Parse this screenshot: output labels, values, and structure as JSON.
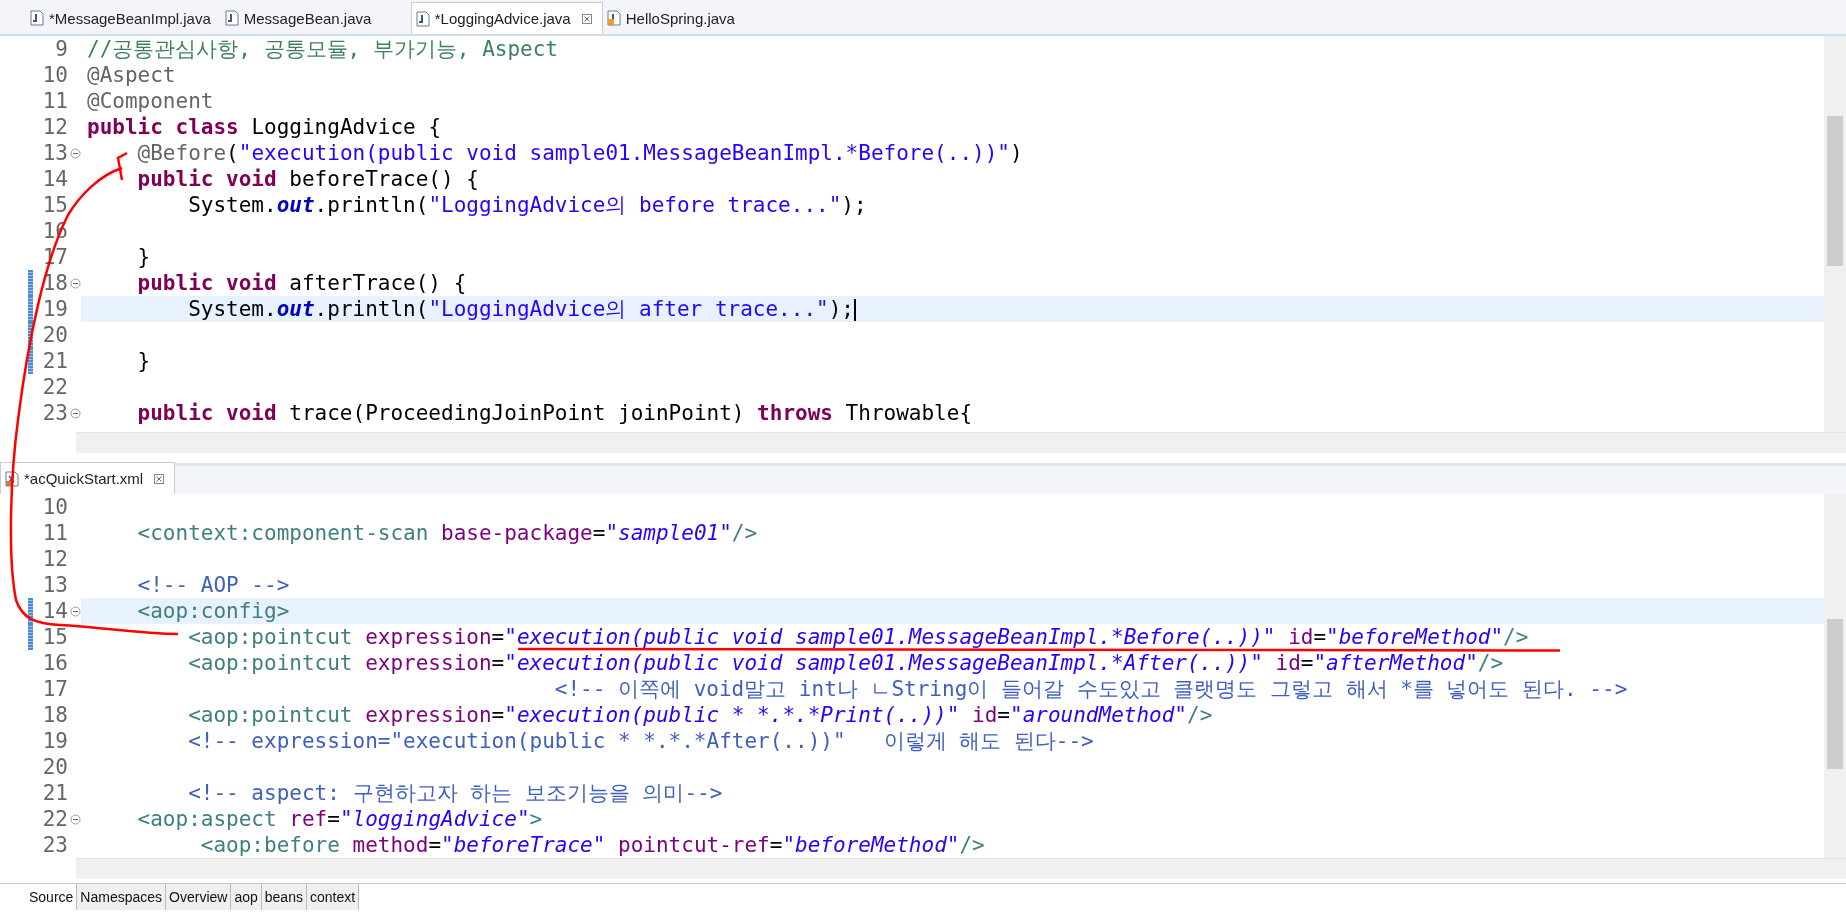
{
  "editor_tabs": [
    {
      "label": "*MessageBeanImpl.java",
      "selected": false,
      "kind": "java"
    },
    {
      "label": "MessageBean.java",
      "selected": false,
      "kind": "java"
    },
    {
      "label": "*LoggingAdvice.java",
      "selected": true,
      "kind": "java"
    },
    {
      "label": "HelloSpring.java",
      "selected": false,
      "kind": "java-main"
    }
  ],
  "java_editor": {
    "lines": [
      {
        "number": "9",
        "fold": false,
        "current": false,
        "marked": false,
        "caret": false,
        "tokens": [
          {
            "kind": "comment",
            "text": "//공통관심사항, 공통모듈, 부가기능, Aspect"
          }
        ]
      },
      {
        "number": "10",
        "fold": false,
        "current": false,
        "marked": false,
        "caret": false,
        "tokens": [
          {
            "kind": "annotation",
            "text": "@Aspect"
          }
        ]
      },
      {
        "number": "11",
        "fold": false,
        "current": false,
        "marked": false,
        "caret": false,
        "tokens": [
          {
            "kind": "annotation",
            "text": "@Component"
          }
        ]
      },
      {
        "number": "12",
        "fold": false,
        "current": false,
        "marked": false,
        "caret": false,
        "tokens": [
          {
            "kind": "keyword",
            "text": "public class "
          },
          {
            "kind": "plain",
            "text": "LoggingAdvice {"
          }
        ]
      },
      {
        "number": "13",
        "fold": true,
        "current": false,
        "marked": false,
        "caret": false,
        "tokens": [
          {
            "kind": "annotation",
            "text": "    @Before"
          },
          {
            "kind": "plain",
            "text": "("
          },
          {
            "kind": "string",
            "text": "\"execution(public void sample01.MessageBeanImpl.*Before(..))\""
          },
          {
            "kind": "plain",
            "text": ")"
          }
        ]
      },
      {
        "number": "14",
        "fold": false,
        "current": false,
        "marked": false,
        "caret": false,
        "tokens": [
          {
            "kind": "keyword",
            "text": "    public void "
          },
          {
            "kind": "plain",
            "text": "beforeTrace() {"
          }
        ]
      },
      {
        "number": "15",
        "fold": false,
        "current": false,
        "marked": false,
        "caret": false,
        "tokens": [
          {
            "kind": "plain",
            "text": "        System."
          },
          {
            "kind": "field",
            "text": "out"
          },
          {
            "kind": "plain",
            "text": ".println("
          },
          {
            "kind": "string",
            "text": "\"LoggingAdvice의 before trace...\""
          },
          {
            "kind": "plain",
            "text": ");"
          }
        ]
      },
      {
        "number": "16",
        "fold": false,
        "current": false,
        "marked": false,
        "caret": false
      },
      {
        "number": "17",
        "fold": false,
        "current": false,
        "marked": false,
        "caret": false,
        "tokens": [
          {
            "kind": "plain",
            "text": "    }"
          }
        ]
      },
      {
        "number": "18",
        "fold": true,
        "current": false,
        "marked": true,
        "caret": false,
        "tokens": [
          {
            "kind": "keyword",
            "text": "    public void "
          },
          {
            "kind": "plain",
            "text": "afterTrace() {"
          }
        ]
      },
      {
        "number": "19",
        "fold": false,
        "current": true,
        "marked": true,
        "caret": true,
        "tokens": [
          {
            "kind": "plain",
            "text": "        System."
          },
          {
            "kind": "field",
            "text": "out"
          },
          {
            "kind": "plain",
            "text": ".println("
          },
          {
            "kind": "string",
            "text": "\"LoggingAdvice의 after trace...\""
          },
          {
            "kind": "plain",
            "text": ");"
          }
        ]
      },
      {
        "number": "20",
        "fold": false,
        "current": false,
        "marked": true,
        "caret": false
      },
      {
        "number": "21",
        "fold": false,
        "current": false,
        "marked": true,
        "caret": false,
        "tokens": [
          {
            "kind": "plain",
            "text": "    }"
          }
        ]
      },
      {
        "number": "22",
        "fold": false,
        "current": false,
        "marked": false,
        "caret": false
      },
      {
        "number": "23",
        "fold": true,
        "current": false,
        "marked": false,
        "caret": false,
        "tokens": [
          {
            "kind": "keyword",
            "text": "    public void "
          },
          {
            "kind": "plain",
            "text": "trace(ProceedingJoinPoint joinPoint) "
          },
          {
            "kind": "keyword",
            "text": "throws "
          },
          {
            "kind": "plain",
            "text": "Throwable{"
          }
        ]
      }
    ]
  },
  "xml_tab": {
    "label": "*acQuickStart.xml",
    "selected": true
  },
  "xml_editor": {
    "lines": [
      {
        "number": "10",
        "fold": false,
        "current": false,
        "marked": false,
        "caret": false
      },
      {
        "number": "11",
        "fold": false,
        "current": false,
        "marked": false,
        "caret": false,
        "tokens": [
          {
            "kind": "tag",
            "text": "    <context:component-scan "
          },
          {
            "kind": "attr",
            "text": "base-package"
          },
          {
            "kind": "plain",
            "text": "="
          },
          {
            "kind": "value",
            "text": "\"sample01\""
          },
          {
            "kind": "tag",
            "text": "/>"
          }
        ]
      },
      {
        "number": "12",
        "fold": false,
        "current": false,
        "marked": false,
        "caret": false
      },
      {
        "number": "13",
        "fold": false,
        "current": false,
        "marked": false,
        "caret": false,
        "tokens": [
          {
            "kind": "xmlcomment",
            "text": "    <!-- AOP -->"
          }
        ]
      },
      {
        "number": "14",
        "fold": true,
        "current": true,
        "marked": true,
        "caret": false,
        "tokens": [
          {
            "kind": "tag",
            "text": "    <aop:config>"
          }
        ]
      },
      {
        "number": "15",
        "fold": false,
        "current": false,
        "marked": true,
        "caret": false,
        "tokens": [
          {
            "kind": "tag",
            "text": "        <aop:pointcut "
          },
          {
            "kind": "attr",
            "text": "expression"
          },
          {
            "kind": "plain",
            "text": "="
          },
          {
            "kind": "value",
            "text": "\"execution(public void sample01.MessageBeanImpl.*Before(..))\""
          },
          {
            "kind": "attr",
            "text": " id"
          },
          {
            "kind": "plain",
            "text": "="
          },
          {
            "kind": "value",
            "text": "\"beforeMethod\""
          },
          {
            "kind": "tag",
            "text": "/>"
          }
        ]
      },
      {
        "number": "16",
        "fold": false,
        "current": false,
        "marked": false,
        "caret": false,
        "tokens": [
          {
            "kind": "tag",
            "text": "        <aop:pointcut "
          },
          {
            "kind": "attr",
            "text": "expression"
          },
          {
            "kind": "plain",
            "text": "="
          },
          {
            "kind": "value",
            "text": "\"execution(public void sample01.MessageBeanImpl.*After(..))\""
          },
          {
            "kind": "attr",
            "text": " id"
          },
          {
            "kind": "plain",
            "text": "="
          },
          {
            "kind": "value",
            "text": "\"afterMethod\""
          },
          {
            "kind": "tag",
            "text": "/>"
          }
        ]
      },
      {
        "number": "17",
        "fold": false,
        "current": false,
        "marked": false,
        "caret": false,
        "tokens": [
          {
            "kind": "xmlcomment",
            "text": "                                     <!-- 이쪽에 void말고 int나 ㄴString이 들어갈 수도있고 클랫명도 그렇고 해서 *를 넣어도 된다. -->"
          }
        ]
      },
      {
        "number": "18",
        "fold": false,
        "current": false,
        "marked": false,
        "caret": false,
        "tokens": [
          {
            "kind": "tag",
            "text": "        <aop:pointcut "
          },
          {
            "kind": "attr",
            "text": "expression"
          },
          {
            "kind": "plain",
            "text": "="
          },
          {
            "kind": "value",
            "text": "\"execution(public * *.*.*Print(..))\""
          },
          {
            "kind": "attr",
            "text": " id"
          },
          {
            "kind": "plain",
            "text": "="
          },
          {
            "kind": "value",
            "text": "\"aroundMethod\""
          },
          {
            "kind": "tag",
            "text": "/>"
          }
        ]
      },
      {
        "number": "19",
        "fold": false,
        "current": false,
        "marked": false,
        "caret": false,
        "tokens": [
          {
            "kind": "xmlcomment",
            "text": "        <!-- expression=\"execution(public * *.*.*After(..))\"   이렇게 해도 된다-->"
          }
        ]
      },
      {
        "number": "20",
        "fold": false,
        "current": false,
        "marked": false,
        "caret": false
      },
      {
        "number": "21",
        "fold": false,
        "current": false,
        "marked": false,
        "caret": false,
        "tokens": [
          {
            "kind": "xmlcomment",
            "text": "        <!-- aspect: 구현하고자 하는 보조기능을 의미-->"
          }
        ]
      },
      {
        "number": "22",
        "fold": true,
        "current": false,
        "marked": false,
        "caret": false,
        "tokens": [
          {
            "kind": "tag",
            "text": "    <aop:aspect "
          },
          {
            "kind": "attr",
            "text": "ref"
          },
          {
            "kind": "plain",
            "text": "="
          },
          {
            "kind": "value",
            "text": "\"loggingAdvice\""
          },
          {
            "kind": "tag",
            "text": ">"
          }
        ]
      },
      {
        "number": "23",
        "fold": false,
        "current": false,
        "marked": false,
        "caret": false,
        "tokens": [
          {
            "kind": "tag",
            "text": "         <aop:before "
          },
          {
            "kind": "attr",
            "text": "method"
          },
          {
            "kind": "plain",
            "text": "="
          },
          {
            "kind": "value",
            "text": "\"beforeTrace\""
          },
          {
            "kind": "attr",
            "text": " pointcut-ref"
          },
          {
            "kind": "plain",
            "text": "="
          },
          {
            "kind": "value",
            "text": "\"beforeMethod\""
          },
          {
            "kind": "tag",
            "text": "/>"
          }
        ]
      }
    ]
  },
  "page_tabs": [
    {
      "label": "Source",
      "selected": true
    },
    {
      "label": "Namespaces",
      "selected": false
    },
    {
      "label": "Overview",
      "selected": false
    },
    {
      "label": "aop",
      "selected": false
    },
    {
      "label": "beans",
      "selected": false
    },
    {
      "label": "context",
      "selected": false
    }
  ]
}
